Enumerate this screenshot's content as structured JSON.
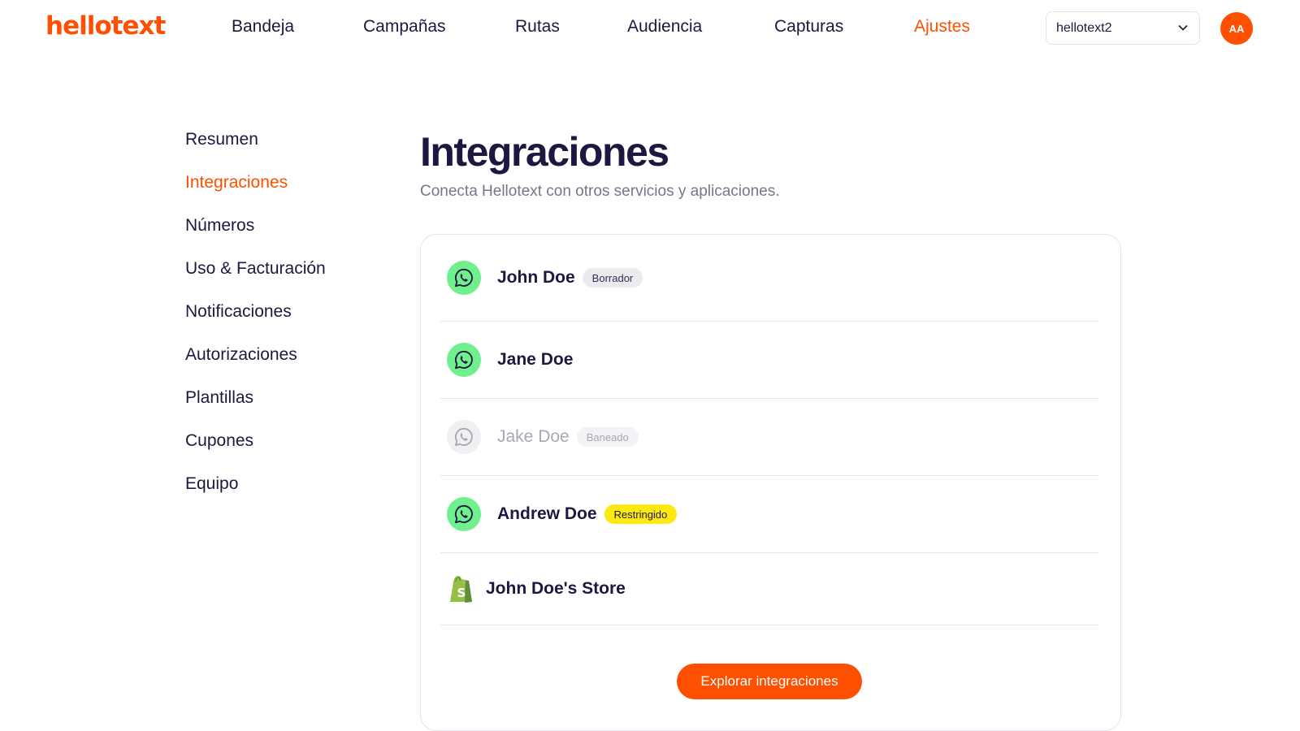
{
  "brand": {
    "logo_text": "hellotext",
    "accent_color": "#ff4f00"
  },
  "nav": {
    "items": [
      {
        "label": "Bandeja"
      },
      {
        "label": "Campañas"
      },
      {
        "label": "Rutas"
      },
      {
        "label": "Audiencia"
      },
      {
        "label": "Capturas"
      },
      {
        "label": "Ajustes",
        "active": true
      }
    ],
    "workspace": {
      "selected": "hellotext2",
      "icon": "chevron-down-icon"
    },
    "avatar_initials": "AA"
  },
  "settings_menu": {
    "items": [
      {
        "label": "Resumen"
      },
      {
        "label": "Integraciones",
        "active": true
      },
      {
        "label": "Números"
      },
      {
        "label": "Uso & Facturación"
      },
      {
        "label": "Notificaciones"
      },
      {
        "label": "Autorizaciones"
      },
      {
        "label": "Plantillas"
      },
      {
        "label": "Cupones"
      },
      {
        "label": "Equipo"
      }
    ]
  },
  "page": {
    "title": "Integraciones",
    "subtitle": "Conecta Hellotext con otros servicios y aplicaciones."
  },
  "integrations": [
    {
      "name": "John Doe",
      "icon": "whatsapp-icon",
      "badge": "Borrador",
      "status": "draft"
    },
    {
      "name": "Jane Doe",
      "icon": "whatsapp-icon",
      "badge": "",
      "status": "active"
    },
    {
      "name": "Jake Doe",
      "icon": "whatsapp-icon",
      "badge": "Baneado",
      "status": "banned"
    },
    {
      "name": "Andrew Doe",
      "icon": "whatsapp-icon",
      "badge": "Restringido",
      "status": "restricted"
    },
    {
      "name": "John Doe's Store",
      "icon": "shopify-icon",
      "badge": "",
      "status": "active"
    }
  ],
  "explore_button": {
    "label": "Explorar integraciones"
  },
  "colors": {
    "whatsapp_green": "#6ff08c",
    "restricted_yellow": "#fde910",
    "text_dark": "#1c1840",
    "text_muted": "#77758c"
  }
}
